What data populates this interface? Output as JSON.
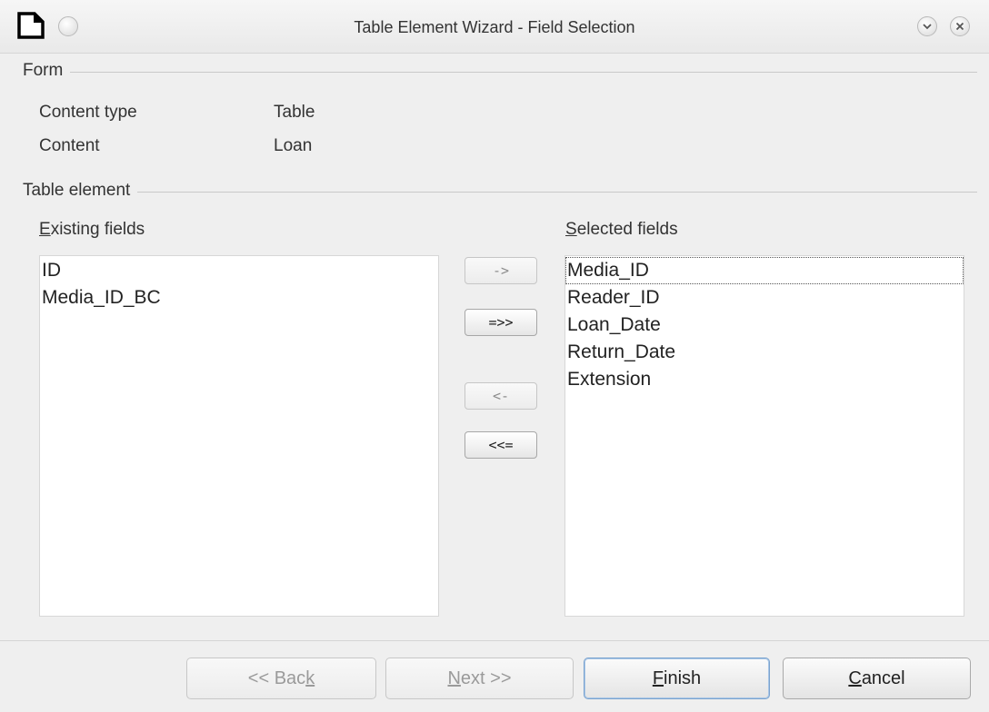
{
  "window": {
    "title": "Table Element Wizard - Field Selection",
    "icons": [
      "document-app-icon",
      "window-menu-icon",
      "minimize-icon",
      "close-icon"
    ]
  },
  "form": {
    "section_label": "Form",
    "content_type_label": "Content type",
    "content_type_value": "Table",
    "content_label": "Content",
    "content_value": "Loan"
  },
  "table_element": {
    "section_label": "Table element",
    "existing_fields_label": {
      "mnemonic": "E",
      "rest": "xisting fields"
    },
    "selected_fields_label": {
      "mnemonic": "S",
      "rest": "elected fields"
    },
    "existing_fields": [
      "ID",
      "Media_ID_BC"
    ],
    "selected_fields": [
      "Media_ID",
      "Reader_ID",
      "Loan_Date",
      "Return_Date",
      "Extension"
    ],
    "focused_selected_field": "Media_ID"
  },
  "move_buttons": {
    "add_one": "->",
    "add_all": "=>>",
    "remove_one": "<-",
    "remove_all": "<<="
  },
  "footer": {
    "back": {
      "before": "<< Bac",
      "mnemonic": "k",
      "after": ""
    },
    "next": {
      "before": "",
      "mnemonic": "N",
      "after": "ext >>"
    },
    "finish": {
      "before": "",
      "mnemonic": "F",
      "after": "inish"
    },
    "cancel": {
      "before": "",
      "mnemonic": "C",
      "after": "ancel"
    }
  },
  "colors": {
    "dialog_bg": "#efefef",
    "list_bg": "#ffffff",
    "default_button_border": "#7aa3cf"
  }
}
